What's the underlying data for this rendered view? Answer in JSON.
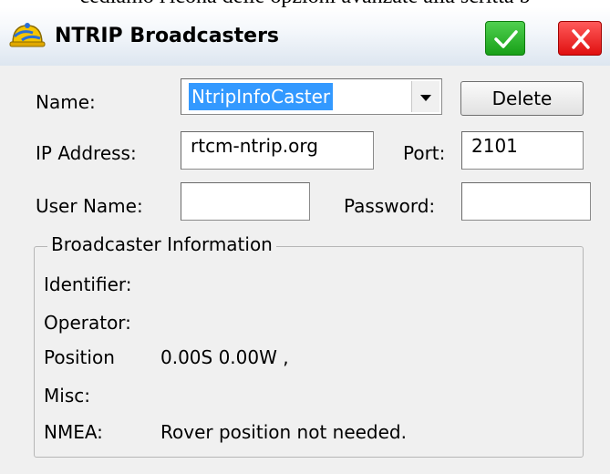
{
  "page_header_fragment": "cediamo l'icona delle opzioni avanzate alla scritta b",
  "window": {
    "title": "NTRIP Broadcasters"
  },
  "form": {
    "name_label": "Name:",
    "name_value": "NtripInfoCaster",
    "delete_label": "Delete",
    "ip_label": "IP Address:",
    "ip_value": "rtcm-ntrip.org",
    "port_label": "Port:",
    "port_value": "2101",
    "user_label": "User Name:",
    "user_value": "",
    "password_label": "Password:",
    "password_value": ""
  },
  "info": {
    "group_title": "Broadcaster Information",
    "identifier_label": "Identifier:",
    "identifier_value": "",
    "operator_label": "Operator:",
    "operator_value": "",
    "position_label": "Position",
    "position_value": "0.00S 0.00W ,",
    "misc_label": "Misc:",
    "misc_value": "",
    "nmea_label": "NMEA:",
    "nmea_value": "Rover position not needed."
  },
  "icons": {
    "app": "hardhat-satellite-icon",
    "ok": "checkmark-icon",
    "close": "close-icon"
  },
  "colors": {
    "ok_button": "#1fa81f",
    "close_button": "#e81818",
    "selection": "#3399ff"
  }
}
